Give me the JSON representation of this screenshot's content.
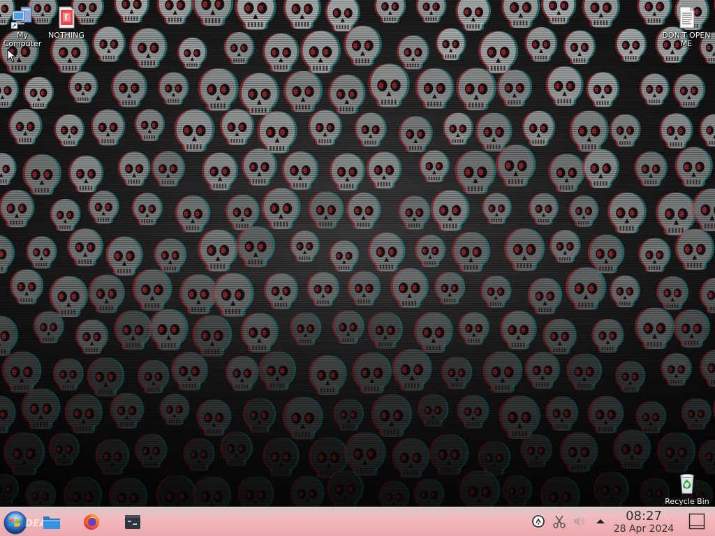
{
  "desktop": {
    "icons": [
      {
        "id": "my-computer",
        "label": "My Computer",
        "icon": "computer-icon"
      },
      {
        "id": "nothing",
        "label": "NOTHING",
        "icon": "document-red-icon"
      },
      {
        "id": "dont-open",
        "label": "DON'T OPEN ME",
        "icon": "text-file-icon"
      },
      {
        "id": "recycle-bin",
        "label": "Recycle Bin",
        "icon": "recycle-bin-icon"
      }
    ],
    "wallpaper": "skulls"
  },
  "taskbar": {
    "start_label": "DEAD",
    "apps": [
      {
        "name": "File Manager",
        "icon": "folder-icon"
      },
      {
        "name": "Firefox",
        "icon": "firefox-icon"
      },
      {
        "name": "Terminal",
        "icon": "terminal-icon"
      }
    ],
    "tray": [
      {
        "icon": "network-icon"
      },
      {
        "icon": "scissors-icon"
      },
      {
        "icon": "volume-icon"
      },
      {
        "icon": "tray-expand-icon"
      }
    ],
    "clock": {
      "time": "08:27",
      "date": "28 Apr 2024"
    },
    "colors": {
      "taskbar": "#f0b7ba",
      "text": "#333333"
    }
  }
}
